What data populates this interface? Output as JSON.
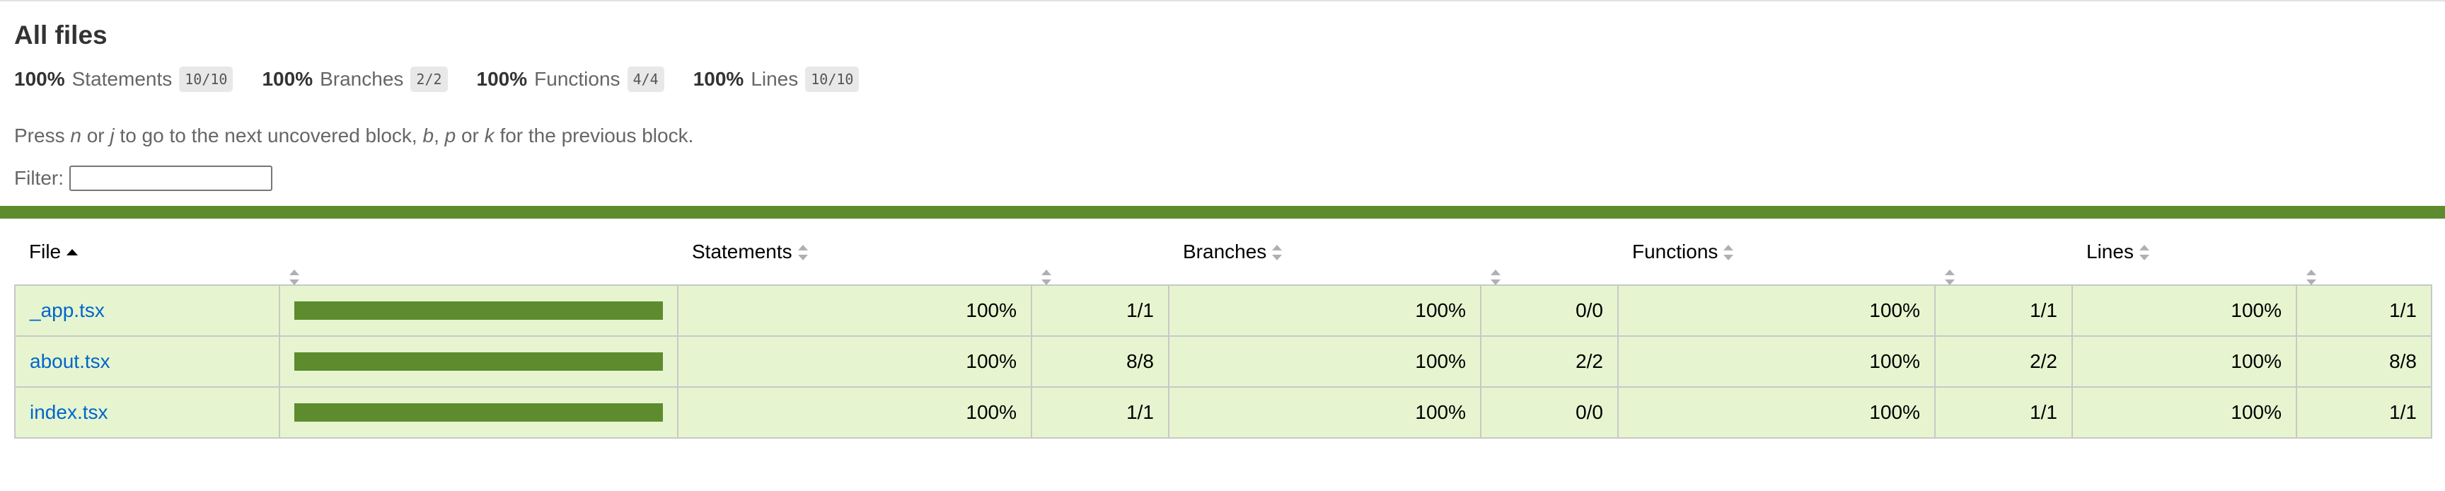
{
  "title": "All files",
  "summary": [
    {
      "pct": "100%",
      "label": "Statements",
      "fraction": "10/10"
    },
    {
      "pct": "100%",
      "label": "Branches",
      "fraction": "2/2"
    },
    {
      "pct": "100%",
      "label": "Functions",
      "fraction": "4/4"
    },
    {
      "pct": "100%",
      "label": "Lines",
      "fraction": "10/10"
    }
  ],
  "hint": {
    "t1": "Press ",
    "k1": "n",
    "t2": " or ",
    "k2": "j",
    "t3": " to go to the next uncovered block, ",
    "k3": "b",
    "t4": ", ",
    "k4": "p",
    "t5": " or ",
    "k5": "k",
    "t6": " for the previous block."
  },
  "filter": {
    "label": "Filter:",
    "value": ""
  },
  "colors": {
    "high": "#e6f5d0",
    "bar": "#5d8b2e",
    "link": "#0066cc"
  },
  "table": {
    "headers": {
      "file": "File",
      "statements": "Statements",
      "branches": "Branches",
      "functions": "Functions",
      "lines": "Lines"
    },
    "rows": [
      {
        "file": "_app.tsx",
        "coverage": 1.0,
        "statements_pct": "100%",
        "statements": "1/1",
        "branches_pct": "100%",
        "branches": "0/0",
        "functions_pct": "100%",
        "functions": "1/1",
        "lines_pct": "100%",
        "lines": "1/1"
      },
      {
        "file": "about.tsx",
        "coverage": 1.0,
        "statements_pct": "100%",
        "statements": "8/8",
        "branches_pct": "100%",
        "branches": "2/2",
        "functions_pct": "100%",
        "functions": "2/2",
        "lines_pct": "100%",
        "lines": "8/8"
      },
      {
        "file": "index.tsx",
        "coverage": 1.0,
        "statements_pct": "100%",
        "statements": "1/1",
        "branches_pct": "100%",
        "branches": "0/0",
        "functions_pct": "100%",
        "functions": "1/1",
        "lines_pct": "100%",
        "lines": "1/1"
      }
    ]
  }
}
